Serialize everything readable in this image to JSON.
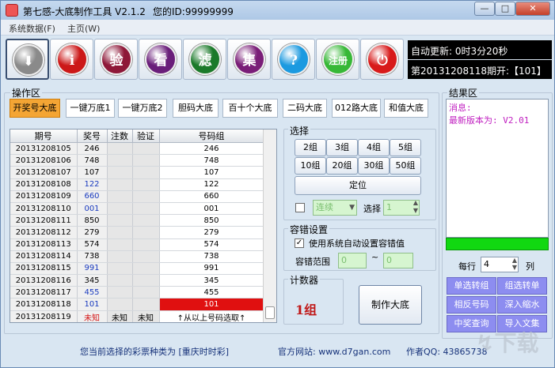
{
  "window": {
    "title": "第七感-大底制作工具 V2.1.2",
    "id_text": "您的ID:99999999",
    "minimize": "—",
    "maximize": "□",
    "close": "✕"
  },
  "menu": {
    "items": [
      "系统数据(F)",
      "主页(W)"
    ]
  },
  "toolbar": {
    "buttons": [
      {
        "name": "download-button",
        "glyph": "⬇",
        "color": "#8a8a8a"
      },
      {
        "name": "info-button",
        "glyph": "i",
        "color": "#cc1818"
      },
      {
        "name": "verify-button",
        "glyph": "验",
        "color": "#8e1838"
      },
      {
        "name": "view-button",
        "glyph": "看",
        "color": "#6a1e7a"
      },
      {
        "name": "filter-button",
        "glyph": "滤",
        "color": "#1b7a2a"
      },
      {
        "name": "collect-button",
        "glyph": "集",
        "color": "#7a1e78"
      },
      {
        "name": "help-button",
        "glyph": "?",
        "color": "#1c9ae0"
      },
      {
        "name": "register-button",
        "glyph": "注册",
        "color": "#37b837"
      },
      {
        "name": "power-button",
        "glyph": "⏻",
        "color": "#d81a1a"
      }
    ],
    "auto_update": "自动更新:  0时3分20秒",
    "period_info": "第20131208118期开:【101】"
  },
  "operation": {
    "label": "操作区",
    "tabs": [
      "开奖号大底",
      "一键万底1",
      "一键万底2",
      "胆码大底",
      "百十个大底",
      "二码大底",
      "012路大底",
      "和值大底"
    ]
  },
  "grid": {
    "headers": [
      "期号",
      "奖号",
      "注数",
      "验证",
      "号码组"
    ],
    "rows": [
      {
        "period": "20131208105",
        "num": "246",
        "count": "",
        "check": "",
        "group": "246",
        "num_style": ""
      },
      {
        "period": "20131208106",
        "num": "748",
        "count": "",
        "check": "",
        "group": "748",
        "num_style": ""
      },
      {
        "period": "20131208107",
        "num": "107",
        "count": "",
        "check": "",
        "group": "107",
        "num_style": ""
      },
      {
        "period": "20131208108",
        "num": "122",
        "count": "",
        "check": "",
        "group": "122",
        "num_style": "blue"
      },
      {
        "period": "20131208109",
        "num": "660",
        "count": "",
        "check": "",
        "group": "660",
        "num_style": "blue"
      },
      {
        "period": "20131208110",
        "num": "001",
        "count": "",
        "check": "",
        "group": "001",
        "num_style": "blue"
      },
      {
        "period": "20131208111",
        "num": "850",
        "count": "",
        "check": "",
        "group": "850",
        "num_style": ""
      },
      {
        "period": "20131208112",
        "num": "279",
        "count": "",
        "check": "",
        "group": "279",
        "num_style": ""
      },
      {
        "period": "20131208113",
        "num": "574",
        "count": "",
        "check": "",
        "group": "574",
        "num_style": ""
      },
      {
        "period": "20131208114",
        "num": "738",
        "count": "",
        "check": "",
        "group": "738",
        "num_style": ""
      },
      {
        "period": "20131208115",
        "num": "991",
        "count": "",
        "check": "",
        "group": "991",
        "num_style": "blue"
      },
      {
        "period": "20131208116",
        "num": "345",
        "count": "",
        "check": "",
        "group": "345",
        "num_style": ""
      },
      {
        "period": "20131208117",
        "num": "455",
        "count": "",
        "check": "",
        "group": "455",
        "num_style": "blue"
      },
      {
        "period": "20131208118",
        "num": "101",
        "count": "",
        "check": "",
        "group": "101",
        "num_style": "blue"
      },
      {
        "period": "20131208119",
        "num": "未知",
        "count": "未知",
        "check": "未知",
        "group": "↑从以上号码选取↑",
        "num_style": "red"
      }
    ]
  },
  "select": {
    "label": "选择",
    "group_buttons": [
      "2组",
      "3组",
      "4组",
      "5组",
      "10组",
      "20组",
      "30组",
      "50组"
    ],
    "locate": "定位",
    "mode_value": "连续",
    "select_label": "选择",
    "select_value": "1"
  },
  "tolerance": {
    "label": "容错设置",
    "auto_label": "使用系统自动设置容错值",
    "range_label": "容错范围",
    "range_from": "0",
    "tilde": "~",
    "range_to": "0"
  },
  "counter": {
    "label": "计数器",
    "value": "1组"
  },
  "make_button": "制作大底",
  "result": {
    "label": "结果区",
    "line1": "消息:",
    "line2": "最新版本为: V2.01"
  },
  "per_row": {
    "label": "每行",
    "value": "4",
    "unit": "列"
  },
  "actions": [
    "单选转组",
    "组选转单",
    "相反号码",
    "深入缩水",
    "中奖查询",
    "导入文集"
  ],
  "status": {
    "lottery": "您当前选择的彩票种类为  [重庆时时彩]",
    "website": "官方网站: www.d7gan.com",
    "qq": "作者QQ: 43865738"
  }
}
